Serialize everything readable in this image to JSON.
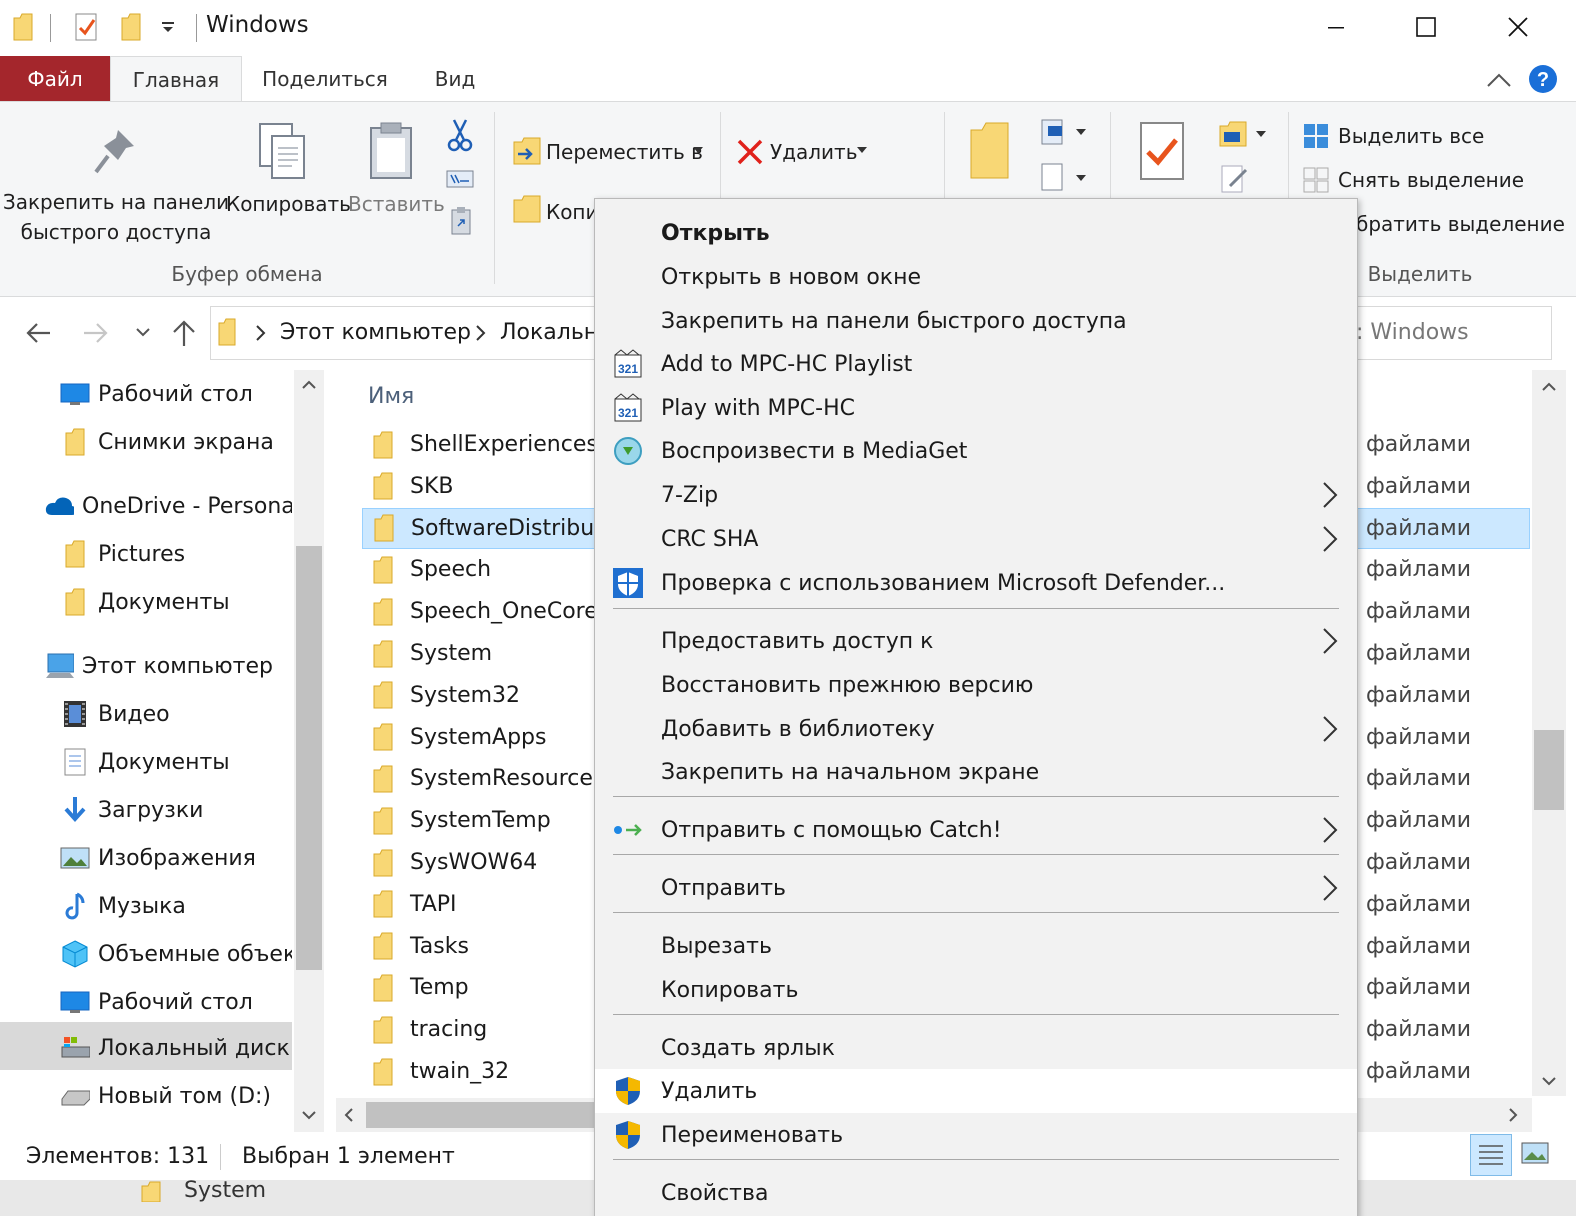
{
  "window": {
    "title": "Windows"
  },
  "ribbon": {
    "tabs": [
      "Файл",
      "Главная",
      "Поделиться",
      "Вид"
    ],
    "pin_label_1": "Закрепить на панели",
    "pin_label_2": "быстрого доступа",
    "copy_label": "Копировать",
    "paste_label": "Вставить",
    "clipboard_group": "Буфер обмена",
    "move_to": "Переместить в",
    "copy_to": "Копи",
    "delete": "Удалить",
    "select_all": "Выделить все",
    "deselect": "Снять выделение",
    "invert": "братить выделение",
    "select_group": "Выделить"
  },
  "address": {
    "crumb1": "Этот компьютер",
    "crumb2": "Локальн",
    "search_suffix": ": Windows"
  },
  "nav": {
    "items": [
      {
        "label": "Рабочий стол",
        "icon": "desktop-icon"
      },
      {
        "label": "Снимки экрана",
        "icon": "folder-icon"
      },
      {
        "label": "OneDrive - Persona",
        "icon": "onedrive-icon"
      },
      {
        "label": "Pictures",
        "icon": "folder-icon"
      },
      {
        "label": "Документы",
        "icon": "folder-icon"
      },
      {
        "label": "Этот компьютер",
        "icon": "computer-icon"
      },
      {
        "label": "Видео",
        "icon": "video-icon"
      },
      {
        "label": "Документы",
        "icon": "documents-icon"
      },
      {
        "label": "Загрузки",
        "icon": "downloads-icon"
      },
      {
        "label": "Изображения",
        "icon": "pictures-icon"
      },
      {
        "label": "Музыка",
        "icon": "music-icon"
      },
      {
        "label": "Объемные объек",
        "icon": "3d-objects-icon"
      },
      {
        "label": "Рабочий стол",
        "icon": "desktop-icon"
      },
      {
        "label": "Локальный диск (",
        "icon": "local-disk-icon"
      },
      {
        "label": "Новый том (D:)",
        "icon": "drive-icon"
      }
    ]
  },
  "files": {
    "column_name": "Имя",
    "type_label": "файлами",
    "rows": [
      "ShellExperiences",
      "SKB",
      "SoftwareDistribut",
      "Speech",
      "Speech_OneCore",
      "System",
      "System32",
      "SystemApps",
      "SystemResources",
      "SystemTemp",
      "SysWOW64",
      "TAPI",
      "Tasks",
      "Temp",
      "tracing",
      "twain_32"
    ]
  },
  "context_menu": {
    "items": [
      {
        "label": "Открыть",
        "bold": true
      },
      {
        "label": "Открыть в новом окне"
      },
      {
        "label": "Закрепить на панели быстрого доступа"
      },
      {
        "label": "Add to MPC-HC Playlist",
        "icon": "mpc-hc-icon"
      },
      {
        "label": "Play with MPC-HC",
        "icon": "mpc-hc-icon"
      },
      {
        "label": "Воспроизвести в MediaGet",
        "icon": "mediaget-icon"
      },
      {
        "label": "7-Zip",
        "submenu": true
      },
      {
        "label": "CRC SHA",
        "submenu": true
      },
      {
        "label": "Проверка с использованием Microsoft Defender...",
        "icon": "defender-icon"
      },
      {
        "label": "Предоставить доступ к",
        "submenu": true
      },
      {
        "label": "Восстановить прежнюю версию"
      },
      {
        "label": "Добавить в библиотеку",
        "submenu": true
      },
      {
        "label": "Закрепить на начальном экране"
      },
      {
        "label": "Отправить с помощью Catch!",
        "icon": "catch-icon",
        "submenu": true
      },
      {
        "label": "Отправить",
        "submenu": true
      },
      {
        "label": "Вырезать"
      },
      {
        "label": "Копировать"
      },
      {
        "label": "Создать ярлык"
      },
      {
        "label": "Удалить",
        "icon": "uac-shield-icon"
      },
      {
        "label": "Переименовать",
        "icon": "uac-shield-icon"
      },
      {
        "label": "Свойства"
      }
    ]
  },
  "status": {
    "count": "Элементов: 131",
    "selected": "Выбран 1 элемент"
  },
  "background": {
    "peek_text": "System"
  },
  "colors": {
    "file_tab": "#a4262c",
    "selection": "#cce8ff",
    "accent": "#0078d7",
    "folder": "#f8d775"
  }
}
